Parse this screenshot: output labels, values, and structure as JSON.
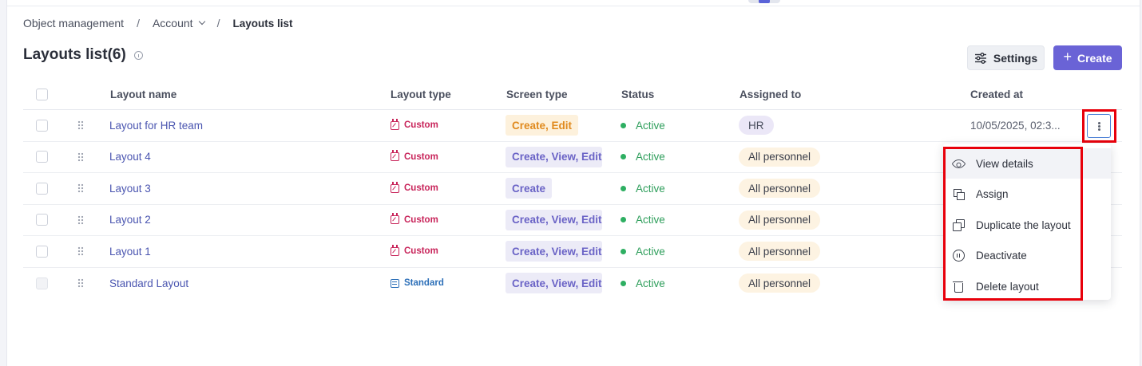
{
  "breadcrumb": {
    "item1": "Object management",
    "item2": "Account",
    "current": "Layouts list",
    "separator": "/"
  },
  "title": "Layouts list(6)",
  "buttons": {
    "settings": "Settings",
    "create": "Create",
    "create_icon": "+"
  },
  "columns": {
    "name": "Layout name",
    "type": "Layout type",
    "screen": "Screen type",
    "status": "Status",
    "assigned": "Assigned to",
    "created": "Created at"
  },
  "rows": [
    {
      "name": "Layout for HR team",
      "type": "Custom",
      "screen": "Create, Edit",
      "status": "Active",
      "assigned": "HR",
      "created": "10/05/2025, 02:3..."
    },
    {
      "name": "Layout 4",
      "type": "Custom",
      "screen": "Create, View, Edit",
      "status": "Active",
      "assigned": "All personnel",
      "created": ""
    },
    {
      "name": "Layout 3",
      "type": "Custom",
      "screen": "Create",
      "status": "Active",
      "assigned": "All personnel",
      "created": ""
    },
    {
      "name": "Layout 2",
      "type": "Custom",
      "screen": "Create, View, Edit",
      "status": "Active",
      "assigned": "All personnel",
      "created": ""
    },
    {
      "name": "Layout 1",
      "type": "Custom",
      "screen": "Create, View, Edit",
      "status": "Active",
      "assigned": "All personnel",
      "created": ""
    },
    {
      "name": "Standard Layout",
      "type": "Standard",
      "screen": "Create, View, Edit",
      "status": "Active",
      "assigned": "All personnel",
      "created": ""
    }
  ],
  "menu": {
    "view": "View details",
    "assign": "Assign",
    "duplicate": "Duplicate the layout",
    "deactivate": "Deactivate",
    "delete": "Delete layout"
  },
  "icons": {
    "info": "info-icon",
    "settings": "sliders-icon",
    "more": "more-vertical-icon",
    "drag": "drag-handle-icon",
    "custom": "calendar-edit-icon",
    "standard": "list-icon"
  },
  "colors": {
    "accent": "#6a63d6",
    "active": "#2e9e5b",
    "custom": "#c8245a",
    "standard": "#2c6fb8",
    "highlight": "#e8000b"
  }
}
